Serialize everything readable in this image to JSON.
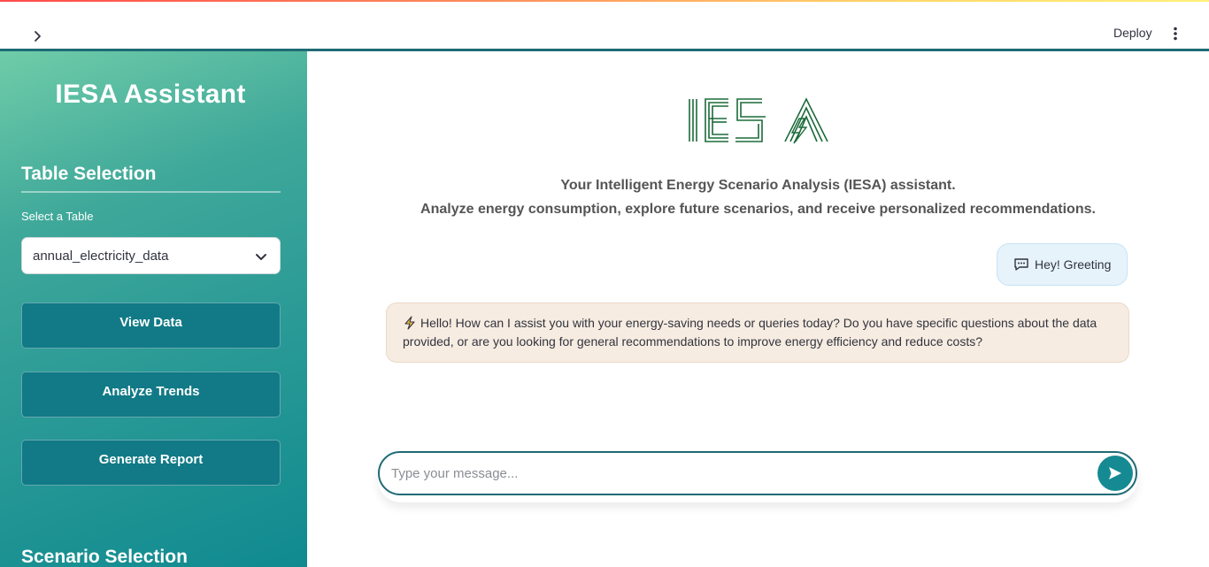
{
  "header": {
    "expand_icon": "chevron-right-icon",
    "deploy_label": "Deploy",
    "menu_icon": "more-vertical-icon"
  },
  "sidebar": {
    "title": "IESA Assistant",
    "table_section_title": "Table Selection",
    "select_label": "Select a Table",
    "selected_table": "annual_electricity_data",
    "buttons": [
      "View Data",
      "Analyze Trends",
      "Generate Report"
    ],
    "scenario_section_title": "Scenario Selection"
  },
  "main": {
    "logo_text": "IESA",
    "tagline_line1": "Your Intelligent Energy Scenario Analysis (IESA) assistant.",
    "tagline_line2": "Analyze energy consumption, explore future scenarios, and receive personalized recommendations.",
    "user_message": "Hey! Greeting",
    "bot_message": "Hello! How can I assist you with your energy-saving needs or queries today? Do you have specific questions about the data provided, or are you looking for general recommendations to improve energy efficiency and reduce costs?",
    "chat_placeholder": "Type your message..."
  },
  "colors": {
    "accent": "#117a86",
    "logo_green": "#1b6b3a",
    "user_bubble": "#e6f3fb",
    "bot_bubble": "#f7ece1"
  }
}
